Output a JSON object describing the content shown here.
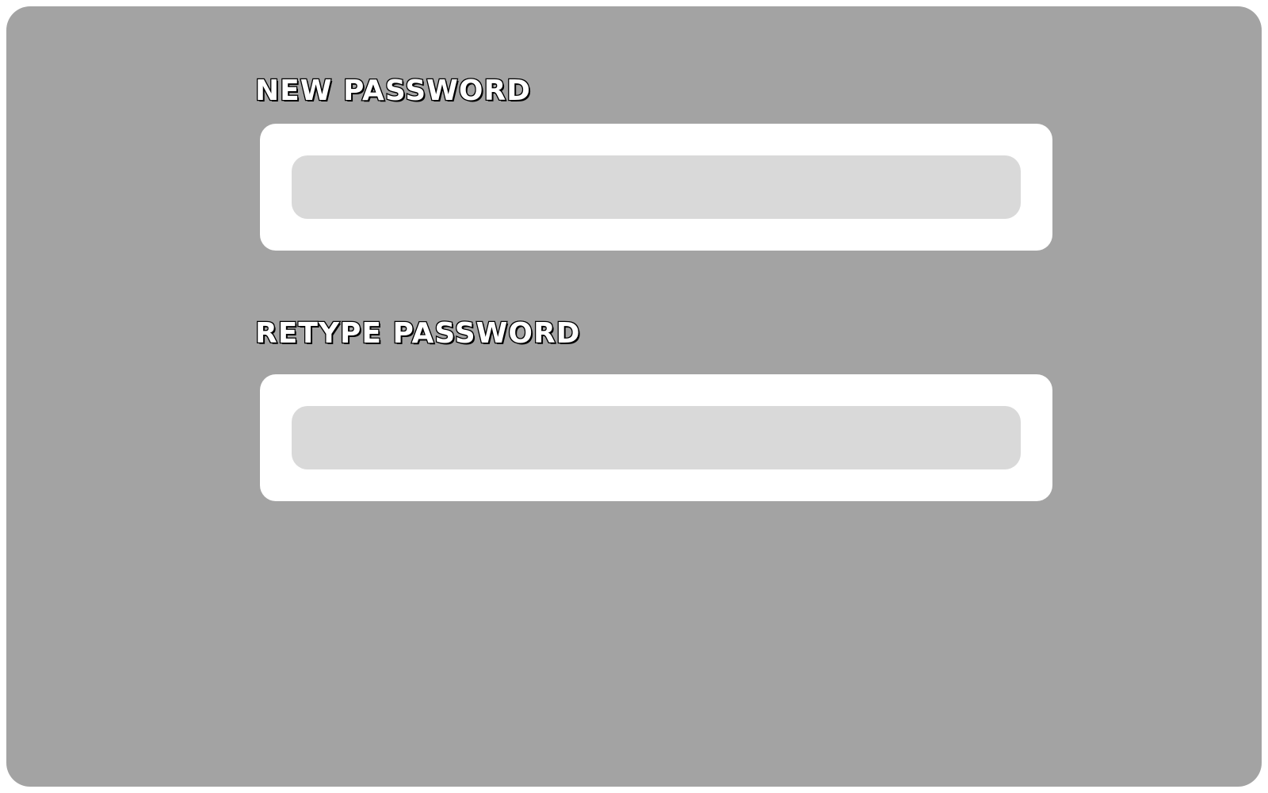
{
  "form": {
    "new_password": {
      "label": "NEW PASSWORD",
      "value": ""
    },
    "retype_password": {
      "label": "RETYPE PASSWORD",
      "value": ""
    }
  },
  "colors": {
    "panel_background": "#a3a3a3",
    "field_container": "#ffffff",
    "input_fill": "#d9d9d9",
    "label_fill": "#ffffff",
    "label_outline": "#000000"
  }
}
